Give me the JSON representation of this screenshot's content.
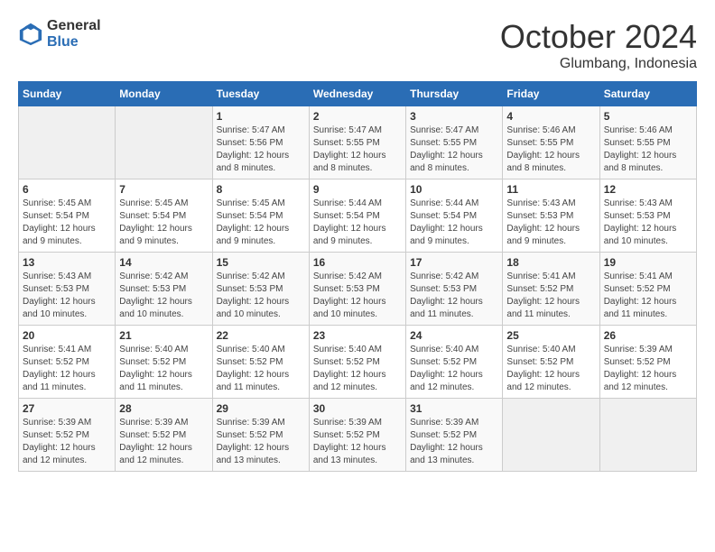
{
  "logo": {
    "general": "General",
    "blue": "Blue"
  },
  "title": "October 2024",
  "location": "Glumbang, Indonesia",
  "headers": [
    "Sunday",
    "Monday",
    "Tuesday",
    "Wednesday",
    "Thursday",
    "Friday",
    "Saturday"
  ],
  "weeks": [
    [
      {
        "day": "",
        "sunrise": "",
        "sunset": "",
        "daylight": ""
      },
      {
        "day": "",
        "sunrise": "",
        "sunset": "",
        "daylight": ""
      },
      {
        "day": "1",
        "sunrise": "Sunrise: 5:47 AM",
        "sunset": "Sunset: 5:56 PM",
        "daylight": "Daylight: 12 hours and 8 minutes."
      },
      {
        "day": "2",
        "sunrise": "Sunrise: 5:47 AM",
        "sunset": "Sunset: 5:55 PM",
        "daylight": "Daylight: 12 hours and 8 minutes."
      },
      {
        "day": "3",
        "sunrise": "Sunrise: 5:47 AM",
        "sunset": "Sunset: 5:55 PM",
        "daylight": "Daylight: 12 hours and 8 minutes."
      },
      {
        "day": "4",
        "sunrise": "Sunrise: 5:46 AM",
        "sunset": "Sunset: 5:55 PM",
        "daylight": "Daylight: 12 hours and 8 minutes."
      },
      {
        "day": "5",
        "sunrise": "Sunrise: 5:46 AM",
        "sunset": "Sunset: 5:55 PM",
        "daylight": "Daylight: 12 hours and 8 minutes."
      }
    ],
    [
      {
        "day": "6",
        "sunrise": "Sunrise: 5:45 AM",
        "sunset": "Sunset: 5:54 PM",
        "daylight": "Daylight: 12 hours and 9 minutes."
      },
      {
        "day": "7",
        "sunrise": "Sunrise: 5:45 AM",
        "sunset": "Sunset: 5:54 PM",
        "daylight": "Daylight: 12 hours and 9 minutes."
      },
      {
        "day": "8",
        "sunrise": "Sunrise: 5:45 AM",
        "sunset": "Sunset: 5:54 PM",
        "daylight": "Daylight: 12 hours and 9 minutes."
      },
      {
        "day": "9",
        "sunrise": "Sunrise: 5:44 AM",
        "sunset": "Sunset: 5:54 PM",
        "daylight": "Daylight: 12 hours and 9 minutes."
      },
      {
        "day": "10",
        "sunrise": "Sunrise: 5:44 AM",
        "sunset": "Sunset: 5:54 PM",
        "daylight": "Daylight: 12 hours and 9 minutes."
      },
      {
        "day": "11",
        "sunrise": "Sunrise: 5:43 AM",
        "sunset": "Sunset: 5:53 PM",
        "daylight": "Daylight: 12 hours and 9 minutes."
      },
      {
        "day": "12",
        "sunrise": "Sunrise: 5:43 AM",
        "sunset": "Sunset: 5:53 PM",
        "daylight": "Daylight: 12 hours and 10 minutes."
      }
    ],
    [
      {
        "day": "13",
        "sunrise": "Sunrise: 5:43 AM",
        "sunset": "Sunset: 5:53 PM",
        "daylight": "Daylight: 12 hours and 10 minutes."
      },
      {
        "day": "14",
        "sunrise": "Sunrise: 5:42 AM",
        "sunset": "Sunset: 5:53 PM",
        "daylight": "Daylight: 12 hours and 10 minutes."
      },
      {
        "day": "15",
        "sunrise": "Sunrise: 5:42 AM",
        "sunset": "Sunset: 5:53 PM",
        "daylight": "Daylight: 12 hours and 10 minutes."
      },
      {
        "day": "16",
        "sunrise": "Sunrise: 5:42 AM",
        "sunset": "Sunset: 5:53 PM",
        "daylight": "Daylight: 12 hours and 10 minutes."
      },
      {
        "day": "17",
        "sunrise": "Sunrise: 5:42 AM",
        "sunset": "Sunset: 5:53 PM",
        "daylight": "Daylight: 12 hours and 11 minutes."
      },
      {
        "day": "18",
        "sunrise": "Sunrise: 5:41 AM",
        "sunset": "Sunset: 5:52 PM",
        "daylight": "Daylight: 12 hours and 11 minutes."
      },
      {
        "day": "19",
        "sunrise": "Sunrise: 5:41 AM",
        "sunset": "Sunset: 5:52 PM",
        "daylight": "Daylight: 12 hours and 11 minutes."
      }
    ],
    [
      {
        "day": "20",
        "sunrise": "Sunrise: 5:41 AM",
        "sunset": "Sunset: 5:52 PM",
        "daylight": "Daylight: 12 hours and 11 minutes."
      },
      {
        "day": "21",
        "sunrise": "Sunrise: 5:40 AM",
        "sunset": "Sunset: 5:52 PM",
        "daylight": "Daylight: 12 hours and 11 minutes."
      },
      {
        "day": "22",
        "sunrise": "Sunrise: 5:40 AM",
        "sunset": "Sunset: 5:52 PM",
        "daylight": "Daylight: 12 hours and 11 minutes."
      },
      {
        "day": "23",
        "sunrise": "Sunrise: 5:40 AM",
        "sunset": "Sunset: 5:52 PM",
        "daylight": "Daylight: 12 hours and 12 minutes."
      },
      {
        "day": "24",
        "sunrise": "Sunrise: 5:40 AM",
        "sunset": "Sunset: 5:52 PM",
        "daylight": "Daylight: 12 hours and 12 minutes."
      },
      {
        "day": "25",
        "sunrise": "Sunrise: 5:40 AM",
        "sunset": "Sunset: 5:52 PM",
        "daylight": "Daylight: 12 hours and 12 minutes."
      },
      {
        "day": "26",
        "sunrise": "Sunrise: 5:39 AM",
        "sunset": "Sunset: 5:52 PM",
        "daylight": "Daylight: 12 hours and 12 minutes."
      }
    ],
    [
      {
        "day": "27",
        "sunrise": "Sunrise: 5:39 AM",
        "sunset": "Sunset: 5:52 PM",
        "daylight": "Daylight: 12 hours and 12 minutes."
      },
      {
        "day": "28",
        "sunrise": "Sunrise: 5:39 AM",
        "sunset": "Sunset: 5:52 PM",
        "daylight": "Daylight: 12 hours and 12 minutes."
      },
      {
        "day": "29",
        "sunrise": "Sunrise: 5:39 AM",
        "sunset": "Sunset: 5:52 PM",
        "daylight": "Daylight: 12 hours and 13 minutes."
      },
      {
        "day": "30",
        "sunrise": "Sunrise: 5:39 AM",
        "sunset": "Sunset: 5:52 PM",
        "daylight": "Daylight: 12 hours and 13 minutes."
      },
      {
        "day": "31",
        "sunrise": "Sunrise: 5:39 AM",
        "sunset": "Sunset: 5:52 PM",
        "daylight": "Daylight: 12 hours and 13 minutes."
      },
      {
        "day": "",
        "sunrise": "",
        "sunset": "",
        "daylight": ""
      },
      {
        "day": "",
        "sunrise": "",
        "sunset": "",
        "daylight": ""
      }
    ]
  ]
}
